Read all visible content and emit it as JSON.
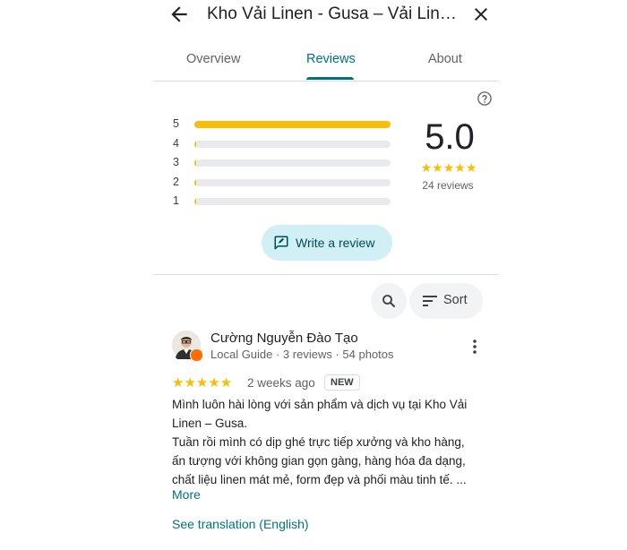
{
  "header": {
    "title": "Kho Vải Linen - Gusa – Vải Linen Cao Cấp"
  },
  "tabs": [
    {
      "label": "Overview",
      "active": false
    },
    {
      "label": "Reviews",
      "active": true
    },
    {
      "label": "About",
      "active": false
    }
  ],
  "rating_summary": {
    "histogram": [
      {
        "label": "5",
        "fraction": 1.0
      },
      {
        "label": "4",
        "fraction": 0.01
      },
      {
        "label": "3",
        "fraction": 0.01
      },
      {
        "label": "2",
        "fraction": 0.01
      },
      {
        "label": "1",
        "fraction": 0.01
      }
    ],
    "score": "5.0",
    "stars": "★★★★★",
    "review_count": "24 reviews"
  },
  "actions": {
    "write_review_label": "Write a review",
    "sort_label": "Sort"
  },
  "review": {
    "author": "Cường Nguyễn Đào Tạo",
    "meta": "Local Guide · 3 reviews · 54 photos",
    "stars": "★★★★★",
    "date": "2 weeks ago",
    "badge": "NEW",
    "text_lines": [
      "Mình luôn hài lòng với sản phẩm và dịch vụ tại Kho Vải",
      "Linen – Gusa.",
      "Tuần rồi mình có dịp ghé trực tiếp xưởng và kho hàng,",
      "ấn tượng với không gian gọn gàng, hàng hóa đa dạng,",
      "chất liệu linen mát mẻ, form đẹp và phối màu tinh tế. ..."
    ],
    "more_label": "More",
    "translate_label": "See translation (English)"
  },
  "colors": {
    "accent": "#00737a",
    "star": "#fbbc04",
    "write_button_bg": "#d0f0f5"
  }
}
